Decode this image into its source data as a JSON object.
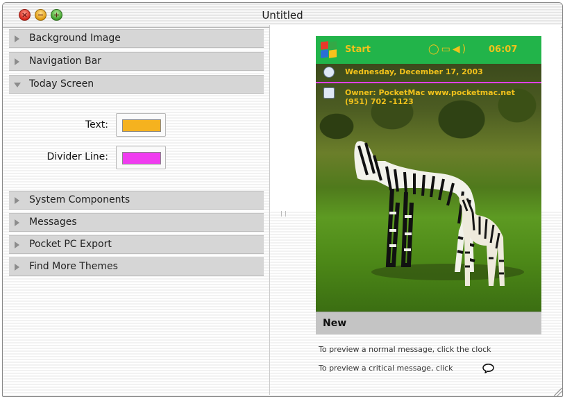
{
  "window": {
    "title": "Untitled"
  },
  "sections": [
    {
      "label": "Background Image",
      "expanded": false
    },
    {
      "label": "Navigation Bar",
      "expanded": false
    },
    {
      "label": "Today Screen",
      "expanded": true
    },
    {
      "label": "System Components",
      "expanded": false
    },
    {
      "label": "Messages",
      "expanded": false
    },
    {
      "label": "Pocket PC Export",
      "expanded": false
    },
    {
      "label": "Find More Themes",
      "expanded": false
    }
  ],
  "today_screen": {
    "text_label": "Text:",
    "text_color": "#f5b21f",
    "divider_label": "Divider Line:",
    "divider_color": "#f03cf0"
  },
  "preview": {
    "start_label": "Start",
    "clock": "06:07",
    "status_icons": [
      "message-icon",
      "battery-icon",
      "volume-icon"
    ],
    "date_line": "Wednesday, December 17, 2003",
    "owner_line1": "Owner: PocketMac www.pocketmac.net",
    "owner_line2": "(951) 702 -1123",
    "menu_new": "New",
    "hint_normal": "To preview a normal message, click the clock",
    "hint_critical": "To preview a critical message, click"
  },
  "colors": {
    "startbar": "#22b44a",
    "today_text": "#f2c21b",
    "divider": "#e040e8"
  }
}
